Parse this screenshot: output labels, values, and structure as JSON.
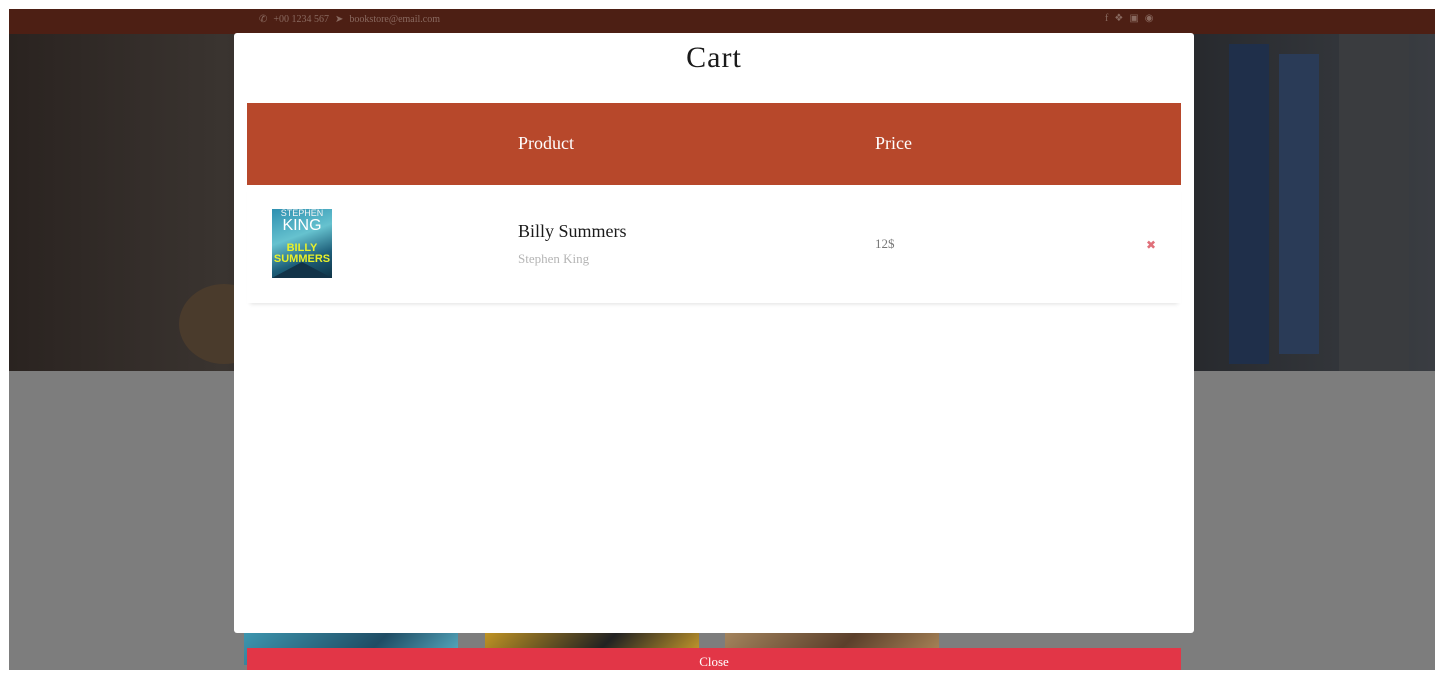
{
  "topbar": {
    "phone_icon": "phone-icon",
    "phone": "+00 1234 567",
    "mail_icon": "paper-plane-icon",
    "email": "bookstore@email.com",
    "social_icons": [
      "facebook-icon",
      "twitter-icon",
      "instagram-icon",
      "dribbble-icon"
    ]
  },
  "modal": {
    "title": "Cart",
    "columns": {
      "product": "Product",
      "price": "Price"
    },
    "items": [
      {
        "cover_text_top": "STEPHEN",
        "cover_text_author": "KING",
        "cover_text_title": "BILLY SUMMERS",
        "title": "Billy Summers",
        "author": "Stephen King",
        "price": "12$",
        "remove_icon": "close-icon",
        "remove_glyph": "✖"
      }
    ],
    "close_label": "Close"
  },
  "colors": {
    "header_bg": "#b7482b",
    "close_btn": "#e23647",
    "topbar": "#4d1f14"
  }
}
